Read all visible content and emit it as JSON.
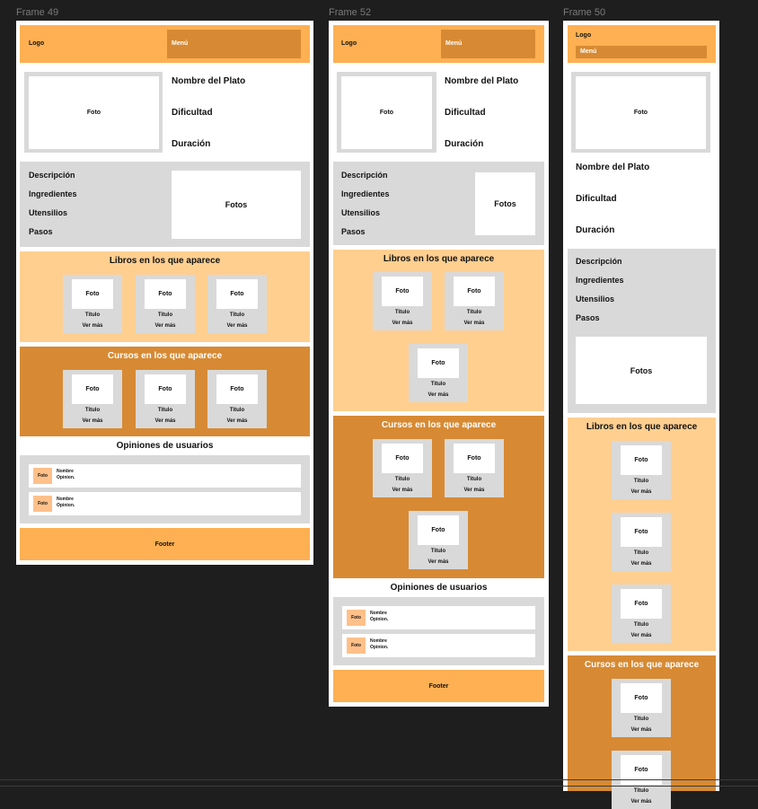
{
  "colors": {
    "header": "#FFB052",
    "menu": "#D78A33",
    "books": "#FFCF90",
    "courses": "#D78A33",
    "gray": "#D9D9D9",
    "avatar": "#FFC08A"
  },
  "frames": [
    {
      "label": "Frame 49",
      "logo": "Logo",
      "menu": "Menú",
      "photo": "Foto",
      "name": "Nombre del Plato",
      "difficulty": "Dificultad",
      "duration": "Duración",
      "details": [
        "Descripción",
        "Ingredientes",
        "Utensilios",
        "Pasos"
      ],
      "photos": "Fotos",
      "books_title": "Libros en los que aparece",
      "courses_title": "Cursos en los que aparece",
      "card": {
        "photo": "Foto",
        "title": "Titulo",
        "more": "Ver más"
      },
      "reviews_title": "Opiniones de usuarios",
      "review": {
        "photo": "Foto",
        "name": "Nombre",
        "text": "Opinion."
      },
      "footer": "Footer"
    },
    {
      "label": "Frame 52",
      "logo": "Logo",
      "menu": "Menú",
      "photo": "Foto",
      "name": "Nombre del Plato",
      "difficulty": "Dificultad",
      "duration": "Duración",
      "details": [
        "Descripción",
        "Ingredientes",
        "Utensilios",
        "Pasos"
      ],
      "photos": "Fotos",
      "books_title": "Libros en los que aparece",
      "courses_title": "Cursos en los que aparece",
      "card": {
        "photo": "Foto",
        "title": "Titulo",
        "more": "Ver más"
      },
      "reviews_title": "Opiniones de usuarios",
      "review": {
        "photo": "Foto",
        "name": "Nombre",
        "text": "Opinion."
      },
      "footer": "Footer"
    },
    {
      "label": "Frame 50",
      "logo": "Logo",
      "menu": "Menú",
      "photo": "Foto",
      "name": "Nombre del Plato",
      "difficulty": "Dificultad",
      "duration": "Duración",
      "details": [
        "Descripción",
        "Ingredientes",
        "Utensilios",
        "Pasos"
      ],
      "photos": "Fotos",
      "books_title": "Libros en los que aparece",
      "courses_title": "Cursos en los que aparece",
      "card": {
        "photo": "Foto",
        "title": "Titulo",
        "more": "Ver más"
      }
    }
  ]
}
